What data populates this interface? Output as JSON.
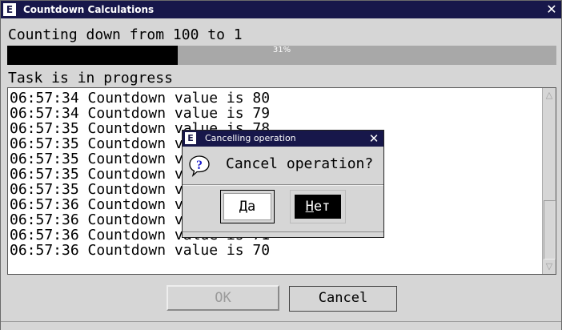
{
  "window": {
    "icon_letter": "E",
    "title": "Countdown Calculations",
    "close_glyph": "✕"
  },
  "main": {
    "heading": "Counting down from 100 to 1",
    "progress": {
      "value_percent": 31,
      "label": "31%"
    },
    "status": "Task is in progress",
    "log_lines": [
      "06:57:34 Countdown value is 80",
      "06:57:34 Countdown value is 79",
      "06:57:35 Countdown value is 78",
      "06:57:35 Countdown value is 77",
      "06:57:35 Countdown value is 76",
      "06:57:35 Countdown value is 75",
      "06:57:35 Countdown value is 74",
      "06:57:36 Countdown value is 73",
      "06:57:36 Countdown value is 72",
      "06:57:36 Countdown value is 71",
      "06:57:36 Countdown value is 70"
    ],
    "scroll_up_glyph": "△",
    "scroll_down_glyph": "▽"
  },
  "buttons": {
    "ok_label": "OK",
    "cancel_label": "Cancel"
  },
  "dialog": {
    "icon_letter": "E",
    "title": "Cancelling operation",
    "close_glyph": "✕",
    "message": "Cancel operation?",
    "yes_access_key": "Д",
    "yes_rest": "а",
    "no_access_key": "Н",
    "no_rest": "ет"
  },
  "colors": {
    "titlebar": "#17174a",
    "window_bg": "#d6d6d6",
    "progress_track": "#a8a8a8",
    "progress_fill": "#000000",
    "question_icon": "#1a1acc"
  }
}
